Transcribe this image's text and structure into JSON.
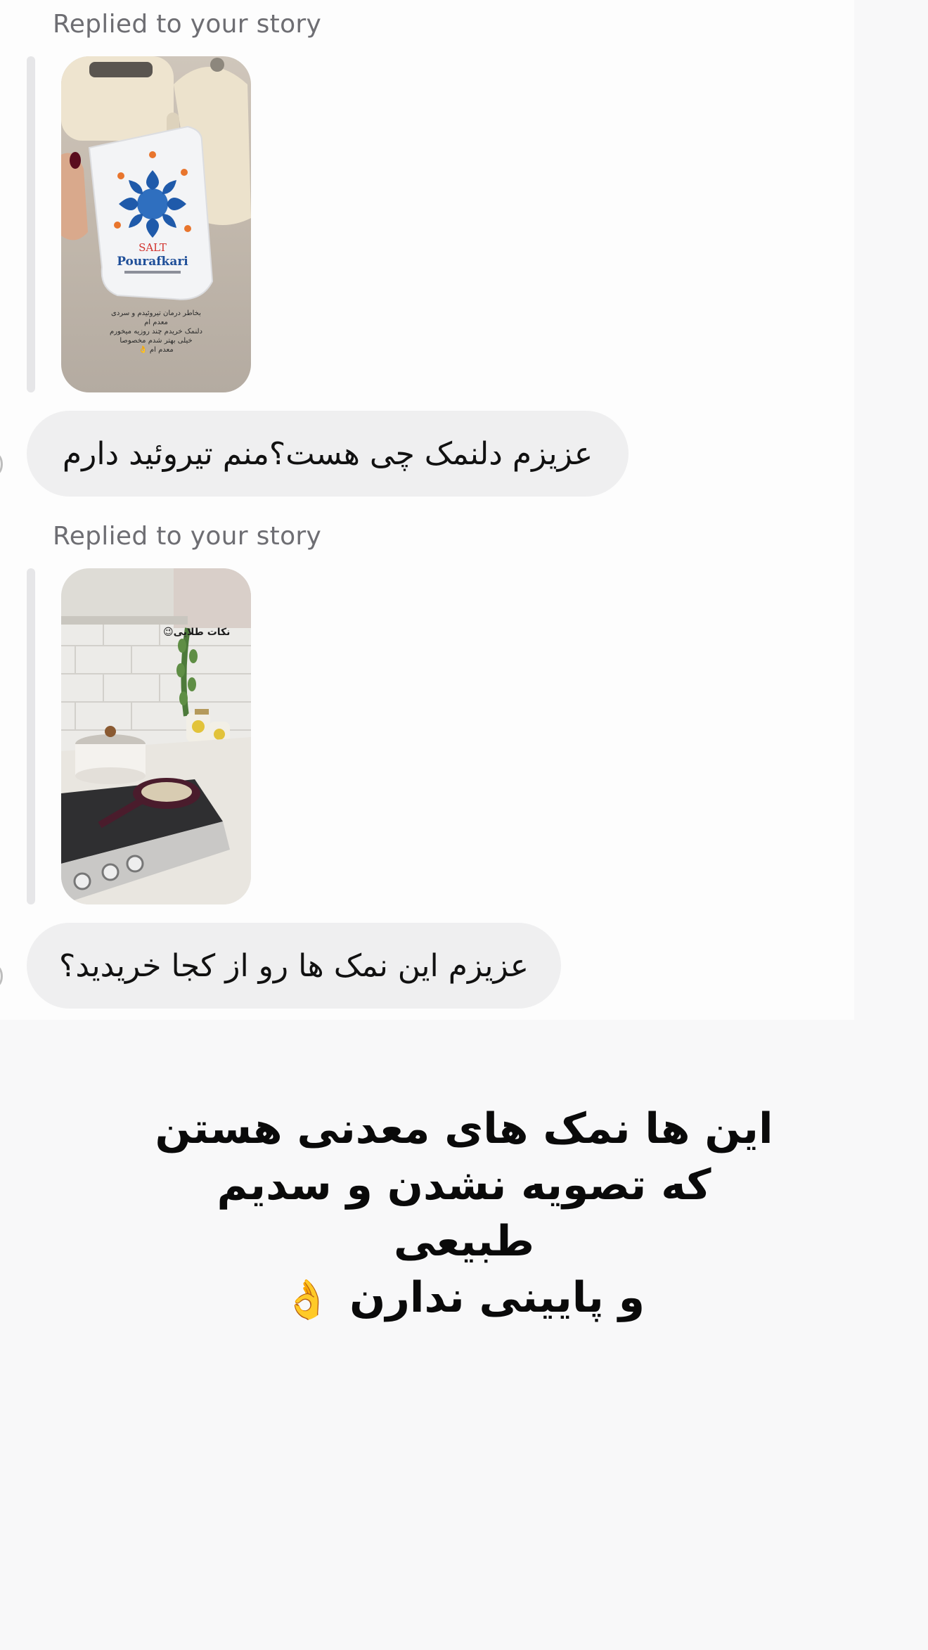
{
  "thread": {
    "messages": [
      {
        "reply_label": "Replied to your story",
        "story_text_lines": [
          "بخاطر درمان تیروئیدم و سردی",
          "معدم ام",
          "دلنمک خریدم چند روزیه میخورم",
          "خیلی بهتر شدم مخصوصا",
          "معدم ام 👌"
        ],
        "story_product_lines": [
          "SALT",
          "Pourafkari"
        ],
        "text": "عزیزم دلنمک چی هست؟منم تیروئید دارم"
      },
      {
        "reply_label": "Replied to your story",
        "story_overlay_text": "نکات طلایی😉",
        "text": "عزیزم این نمک ها رو از کجا خریدید؟"
      }
    ]
  },
  "caption": {
    "line1": "این ها نمک های معدنی هستن",
    "line2": "که تصویه نشدن و سدیم طبیعی",
    "line3": "و پایینی ندارن",
    "emoji": "👌"
  }
}
